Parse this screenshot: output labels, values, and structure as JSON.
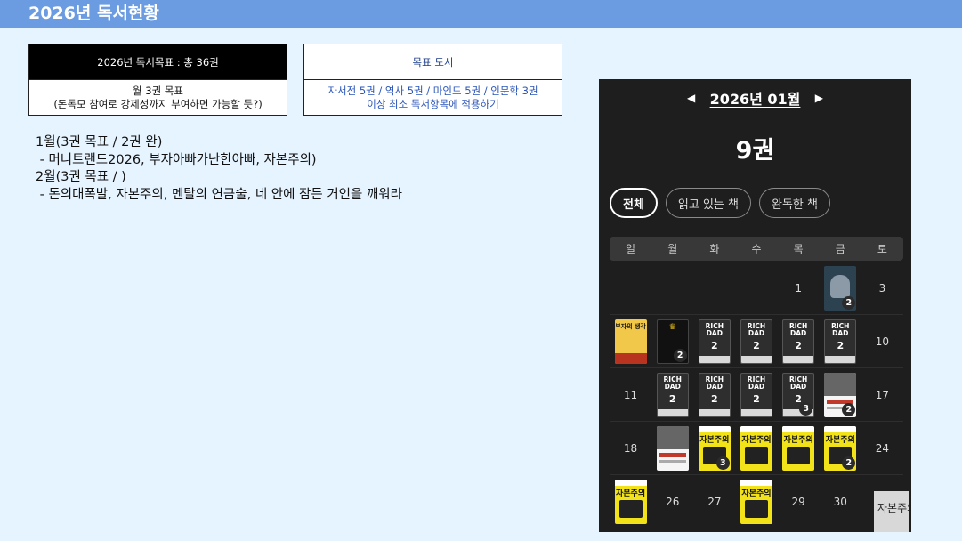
{
  "header": {
    "title": "2026년 독서현황"
  },
  "goal_box": {
    "head": "2026년 독서목표 : 총 36권",
    "line1": "월 3권 목표",
    "line2": "(돈독모 참여로 강제성까지 부여하면 가능할 듯?)"
  },
  "books_box": {
    "head": "목표 도서",
    "line1": "자서전 5권 / 역사 5권 / 마인드 5권 / 인문학 3권",
    "line2": "이상 최소 독서항목에 적용하기"
  },
  "notes": [
    "1월(3권 목표 / 2권 완)",
    " - 머니트랜드2026, 부자아빠가난한아빠, 자본주의)",
    "2월(3권 목표 / )",
    " - 돈의대폭발, 자본주의, 멘탈의 연금술, 네 안에 잠든 거인을 깨워라"
  ],
  "app": {
    "prev_icon": "◀",
    "next_icon": "▶",
    "month": "2026년 01월",
    "count": "9권",
    "filters": [
      "전체",
      "읽고 있는 책",
      "완독한 책"
    ],
    "weekdays": [
      "일",
      "월",
      "화",
      "수",
      "목",
      "금",
      "토"
    ],
    "weeks": [
      [
        {
          "day": ""
        },
        {
          "day": ""
        },
        {
          "day": ""
        },
        {
          "day": ""
        },
        {
          "day": "1"
        },
        {
          "cover": "portrait",
          "badge": "2"
        },
        {
          "day": "3"
        }
      ],
      [
        {
          "cover": "money"
        },
        {
          "cover": "black",
          "badge": "2"
        },
        {
          "cover": "richdad"
        },
        {
          "cover": "richdad"
        },
        {
          "cover": "richdad"
        },
        {
          "cover": "richdad"
        },
        {
          "day": "10"
        }
      ],
      [
        {
          "day": "11"
        },
        {
          "cover": "richdad"
        },
        {
          "cover": "richdad"
        },
        {
          "cover": "richdad"
        },
        {
          "cover": "richdad",
          "badge": "3"
        },
        {
          "cover": "greatness",
          "badge": "2"
        },
        {
          "day": "17"
        }
      ],
      [
        {
          "day": "18"
        },
        {
          "cover": "greatness"
        },
        {
          "cover": "capital",
          "badge": "3"
        },
        {
          "cover": "capital"
        },
        {
          "cover": "capital"
        },
        {
          "cover": "capital",
          "badge": "2"
        },
        {
          "day": "24"
        }
      ],
      [
        {
          "cover": "capital"
        },
        {
          "day": "26"
        },
        {
          "day": "27"
        },
        {
          "cover": "capital"
        },
        {
          "day": "29"
        },
        {
          "day": "30"
        },
        {
          "day": ""
        }
      ]
    ],
    "cover_text": {
      "richdad_title": "RICH DAD",
      "richdad_number": "2",
      "capital_title": "자본주의",
      "money_title": "부자의 생각",
      "black_crown": "♛"
    },
    "edge_cover_title": "자본주의"
  }
}
